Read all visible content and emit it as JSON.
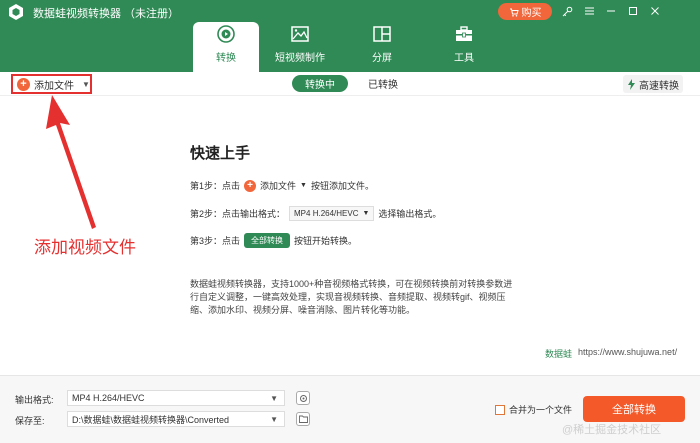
{
  "app": {
    "title": "数据蛙视频转换器 （未注册）",
    "buy_label": "购买",
    "logo_icon": "cube-logo-icon"
  },
  "window_controls": [
    "key-icon",
    "menu-icon",
    "minimize-icon",
    "maximize-icon",
    "close-icon"
  ],
  "tabs": [
    {
      "label": "转换",
      "icon": "convert-icon",
      "active": true
    },
    {
      "label": "短视频制作",
      "icon": "image-icon",
      "active": false
    },
    {
      "label": "分屏",
      "icon": "split-screen-icon",
      "active": false
    },
    {
      "label": "工具",
      "icon": "toolbox-icon",
      "active": false
    }
  ],
  "toolbar": {
    "add_file_label": "添加文件",
    "seg_active": "转换中",
    "seg_other": "已转换",
    "high_speed_label": "高速转换"
  },
  "quickstart": {
    "title": "快速上手",
    "step1_prefix": "第1步：点击",
    "step1_btn": "添加文件",
    "step1_suffix": "按钮添加文件。",
    "step2_prefix": "第2步：点击输出格式：",
    "step2_select": "MP4 H.264/HEVC",
    "step2_suffix": "选择输出格式。",
    "step3_prefix": "第3步：点击",
    "step3_btn": "全部转换",
    "step3_suffix": "按钮开始转换。",
    "description": "数据蛙视频转换器，支持1000+种音视频格式转换，可在视频转换前对转换参数进行自定义调整，一键高效处理，实现音视频转换、音频提取、视频转gif、视频压缩、添加水印、视频分屏、噪音消除、图片转化等功能。"
  },
  "brand": {
    "name": "数据蛙",
    "url": "https://www.shujuwa.net/"
  },
  "annotation": {
    "text": "添加视频文件",
    "color": "#e53030"
  },
  "bottom": {
    "output_label": "输出格式:",
    "output_value": "MP4 H.264/HEVC",
    "save_label": "保存至:",
    "save_value": "D:\\数据蛙\\数据蛙视频转换器\\Converted",
    "merge_label": "合并为一个文件",
    "convert_all_label": "全部转换"
  },
  "watermark": "@稀土掘金技术社区",
  "colors": {
    "header_green": "#2f8a55",
    "accent_orange": "#f45a29",
    "annotation_red": "#e53030"
  }
}
